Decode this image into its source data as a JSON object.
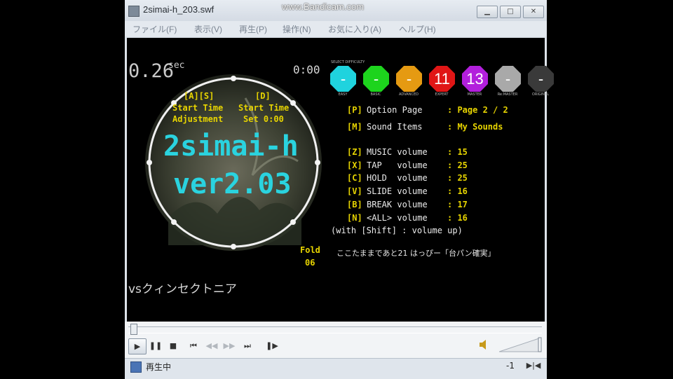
{
  "window": {
    "title": "2simai-h_203.swf",
    "watermark": "www.Bandicam.com"
  },
  "menu": [
    "ファイル(F)",
    "表示(V)",
    "再生(P)",
    "操作(N)",
    "お気に入り(A)",
    "ヘルプ(H)"
  ],
  "game": {
    "timer_value": "0.26",
    "timer_unit": "sec",
    "clock": "0:00",
    "adjust_key": "[A][S]",
    "adjust_line1": "Start Time",
    "adjust_line2": "Adjustment",
    "start_key": "[D]",
    "start_line1": "Start Time",
    "start_line2": "Set 0:00",
    "title_line1": "2simai-h",
    "title_line2": "ver2.03",
    "select_difficulty": "SELECT DIFFICULTY",
    "difficulties": [
      {
        "value": "-",
        "color": "#1fd3de",
        "label": "EASY"
      },
      {
        "value": "-",
        "color": "#1dd41d",
        "label": "BASIC"
      },
      {
        "value": "-",
        "color": "#e59a12",
        "label": "ADVANCED"
      },
      {
        "value": "11",
        "color": "#e01616",
        "label": "EXPERT"
      },
      {
        "value": "13",
        "color": "#b21fdc",
        "label": "MASTER"
      },
      {
        "value": "-",
        "color": "#a9a9a9",
        "label": "Re:MASTER"
      },
      {
        "value": "-",
        "color": "#3a3a3a",
        "label": "ORIGINAL"
      }
    ],
    "options": [
      {
        "key": "[P]",
        "label": "Option Page",
        "value": ": Page 2 / 2"
      },
      {
        "key": "[M]",
        "label": "Sound Items",
        "value": ": My Sounds"
      }
    ],
    "volumes": [
      {
        "key": "[Z]",
        "label": "MUSIC volume",
        "value": ": 15"
      },
      {
        "key": "[X]",
        "label": "TAP   volume",
        "value": ": 25"
      },
      {
        "key": "[C]",
        "label": "HOLD  volume",
        "value": ": 25"
      },
      {
        "key": "[V]",
        "label": "SLIDE volume",
        "value": ": 16"
      },
      {
        "key": "[B]",
        "label": "BREAK volume",
        "value": ": 17"
      },
      {
        "key": "[N]",
        "label": "<ALL> volume",
        "value": ": 16"
      }
    ],
    "shift_hint": "(with [Shift] : volume up)",
    "vs_text": "vsクィンセクトニア",
    "fold_label": "Fold",
    "fold_value": "06",
    "message": "ここたままであと21 はっぴー「台パン確実」"
  },
  "player": {
    "status": "再生中",
    "counter": "-1"
  },
  "colors": {
    "accent_cyan": "#2ad3df",
    "key_yellow": "#e7d400"
  }
}
